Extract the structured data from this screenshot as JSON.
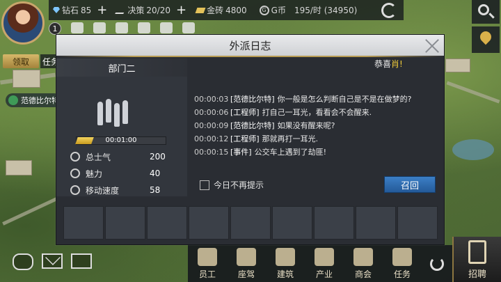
{
  "topbar": {
    "diamond_label": "钻石",
    "diamond_value": "85",
    "decision_label": "决策",
    "decision_value": "20/20",
    "gold_label": "金砖",
    "gold_value": "4800",
    "gcoin_label": "G币",
    "gcoin_value": "195/时 (34950)",
    "plus": "+",
    "g_glyph": "G"
  },
  "left_hud": {
    "badge_count": "1",
    "claim_label": "领取",
    "task_tab_label": "任务",
    "unit_label": "范德比尔特"
  },
  "dialog": {
    "title": "外派日志",
    "department": "部门二",
    "congrats_prefix": "恭喜",
    "congrats_highlight": "肖!",
    "timer": "00:01:00",
    "progress_fraction": 0.18,
    "stats": [
      {
        "label": "总士气",
        "value": "200"
      },
      {
        "label": "魅力",
        "value": "40"
      },
      {
        "label": "移动速度",
        "value": "58"
      }
    ],
    "log": [
      {
        "time": "00:00:03",
        "who": "[范德比尔特]",
        "msg": "你一般是怎么判断自己是不是在做梦的?"
      },
      {
        "time": "00:00:06",
        "who": "[工程师]",
        "msg": "打自己一耳光，看看会不会醒来."
      },
      {
        "time": "00:00:09",
        "who": "[范德比尔特]",
        "msg": "如果没有醒来呢?"
      },
      {
        "time": "00:00:12",
        "who": "[工程师]",
        "msg": "那就再打一耳光."
      },
      {
        "time": "00:00:15",
        "who": "[事件]",
        "msg": "公交车上遇到了劫匪!"
      }
    ],
    "dont_show_label": "今日不再提示",
    "recall_label": "召回"
  },
  "bottom_nav": {
    "items": [
      "员工",
      "座驾",
      "建筑",
      "产业",
      "商会",
      "任务"
    ],
    "recruit_label": "招聘"
  },
  "colors": {
    "accent_gold": "#b79b52",
    "recall_blue": "#3c7fc6",
    "highlight_yellow": "#f5cf3a"
  }
}
